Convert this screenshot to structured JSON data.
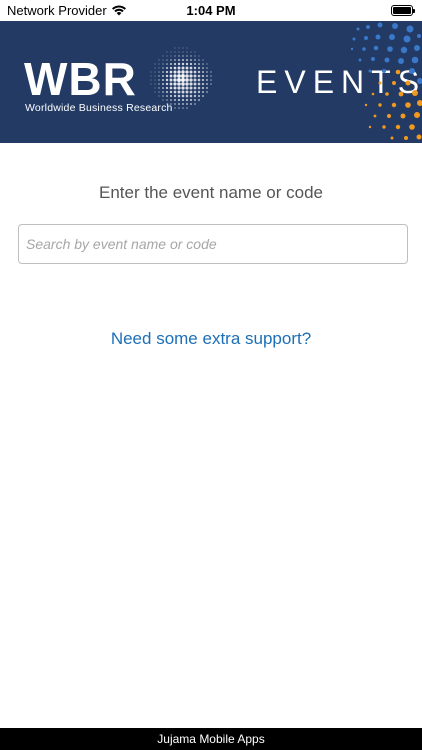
{
  "status_bar": {
    "carrier": "Network Provider",
    "time": "1:04 PM",
    "wifi_icon": "wifi-icon",
    "battery_icon": "battery-icon"
  },
  "banner": {
    "logo_text": "WBR",
    "logo_subtitle": "Worldwide Business Research",
    "events_text": "EVENTS",
    "background_color": "#223a64",
    "dot_colors": [
      "#3a78c9",
      "#f29a1f"
    ]
  },
  "main": {
    "prompt": "Enter the event name or code",
    "search": {
      "value": "",
      "placeholder": "Search by event name or code"
    },
    "support_link": "Need some extra support?",
    "link_color": "#1d6fb6"
  },
  "footer": {
    "text": "Jujama Mobile Apps"
  }
}
